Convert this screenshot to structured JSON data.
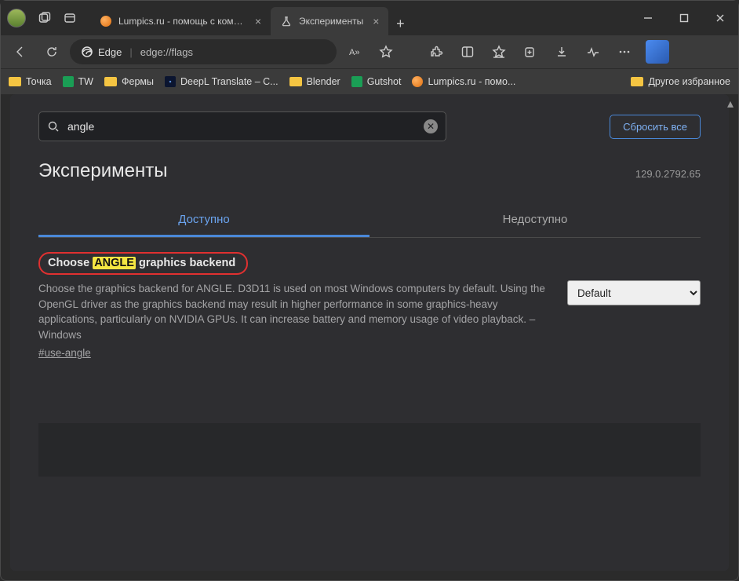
{
  "titlebar": {
    "tabs": [
      {
        "label": "Lumpics.ru - помощь с компьют",
        "active": false
      },
      {
        "label": "Эксперименты",
        "active": true
      }
    ]
  },
  "navbar": {
    "brand": "Edge",
    "url": "edge://flags"
  },
  "bookmarks": [
    {
      "type": "folder",
      "label": "Точка"
    },
    {
      "type": "sheet",
      "label": "TW"
    },
    {
      "type": "folder",
      "label": "Фермы"
    },
    {
      "type": "deepl",
      "label": "DeepL Translate – C..."
    },
    {
      "type": "folder",
      "label": "Blender"
    },
    {
      "type": "sheet",
      "label": "Gutshot"
    },
    {
      "type": "lump",
      "label": "Lumpics.ru - помо..."
    }
  ],
  "bookmarks_other": "Другое избранное",
  "search": {
    "value": "angle"
  },
  "reset_label": "Сбросить все",
  "page_title": "Эксперименты",
  "version": "129.0.2792.65",
  "tabs": {
    "available": "Доступно",
    "unavailable": "Недоступно"
  },
  "flag": {
    "title_pre": "Choose ",
    "title_hl": "ANGLE",
    "title_post": " graphics backend",
    "desc": "Choose the graphics backend for ANGLE. D3D11 is used on most Windows computers by default. Using the OpenGL driver as the graphics backend may result in higher performance in some graphics-heavy applications, particularly on NVIDIA GPUs. It can increase battery and memory usage of video playback. – Windows",
    "hash": "#use-angle",
    "select": "Default"
  }
}
